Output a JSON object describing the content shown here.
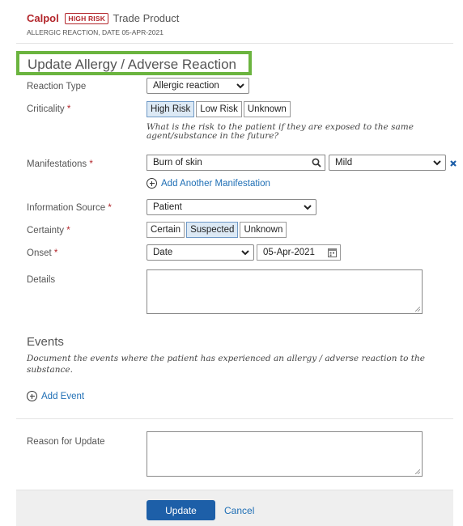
{
  "header": {
    "drug_name": "Calpol",
    "risk_badge": "HIGH RISK",
    "product_type": "Trade Product",
    "subtitle": "ALLERGIC REACTION, DATE 05-APR-2021"
  },
  "form": {
    "title": "Update Allergy / Adverse Reaction",
    "required_mark": "*",
    "reaction_type": {
      "label": "Reaction Type",
      "value": "Allergic reaction"
    },
    "criticality": {
      "label": "Criticality",
      "options": [
        "High Risk",
        "Low Risk",
        "Unknown"
      ],
      "selected": "High Risk",
      "hint": "What is the risk to the patient if they are exposed to the same agent/substance in the future?"
    },
    "manifestations": {
      "label": "Manifestations",
      "value": "Burn of skin",
      "severity": "Mild",
      "add_link": "Add Another Manifestation"
    },
    "information_source": {
      "label": "Information Source",
      "value": "Patient"
    },
    "certainty": {
      "label": "Certainty",
      "options": [
        "Certain",
        "Suspected",
        "Unknown"
      ],
      "selected": "Suspected"
    },
    "onset": {
      "label": "Onset",
      "type_value": "Date",
      "date_value": "05-Apr-2021"
    },
    "details": {
      "label": "Details",
      "value": ""
    }
  },
  "events": {
    "title": "Events",
    "description": "Document the events where the patient has experienced an allergy / adverse reaction to the substance.",
    "add_link": "Add Event"
  },
  "reason": {
    "label": "Reason for Update",
    "value": ""
  },
  "footer": {
    "update_label": "Update",
    "cancel_label": "Cancel"
  },
  "colors": {
    "accent": "#1d5fa8",
    "danger": "#b3262b",
    "highlight_box": "#6bb43f",
    "selected_segment": "#dce9f5"
  }
}
